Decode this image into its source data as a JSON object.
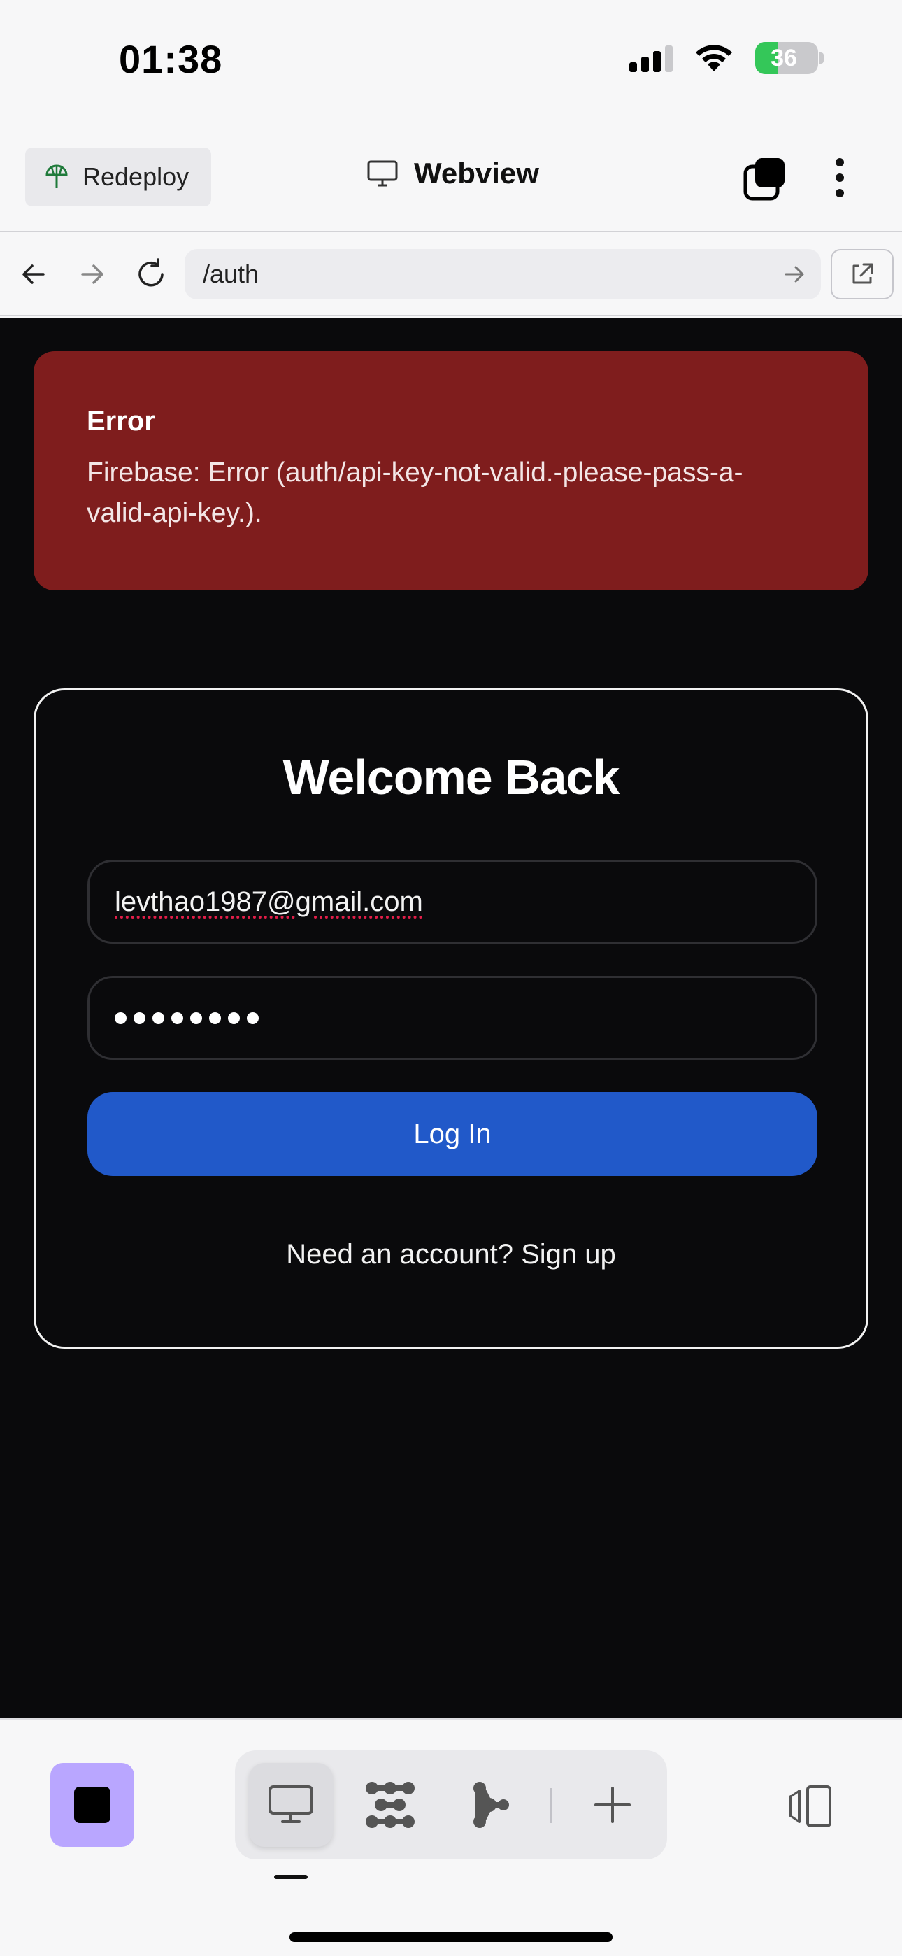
{
  "status_bar": {
    "time": "01:38",
    "battery_level": "36",
    "icons": [
      "signal-icon",
      "wifi-icon",
      "battery-icon"
    ]
  },
  "header": {
    "redeploy_label": "Redeploy",
    "title": "Webview",
    "icons": [
      "redeploy-icon",
      "monitor-icon",
      "tabs-icon",
      "more-icon"
    ]
  },
  "browser": {
    "url": "/auth",
    "icons": [
      "back-icon",
      "forward-icon",
      "reload-icon",
      "go-icon",
      "external-link-icon"
    ]
  },
  "error": {
    "title": "Error",
    "message": "Firebase: Error (auth/api-key-not-valid.-please-pass-a-valid-api-key.)."
  },
  "login": {
    "title": "Welcome Back",
    "email_value": "levthao1987@gmail.com",
    "password_length": 8,
    "login_label": "Log In",
    "signup_text": "Need an account? Sign up"
  },
  "toolbar": {
    "items": [
      "stop-icon",
      "webview-icon",
      "workflows-icon",
      "agent-icon",
      "add-icon",
      "panel-toggle-icon"
    ],
    "active": "webview-icon"
  },
  "colors": {
    "error_bg": "#7f1d1d",
    "primary": "#2159c9",
    "stop_accent": "#b9a6ff",
    "battery_green": "#34c759",
    "webview_bg": "#0a0a0c"
  }
}
